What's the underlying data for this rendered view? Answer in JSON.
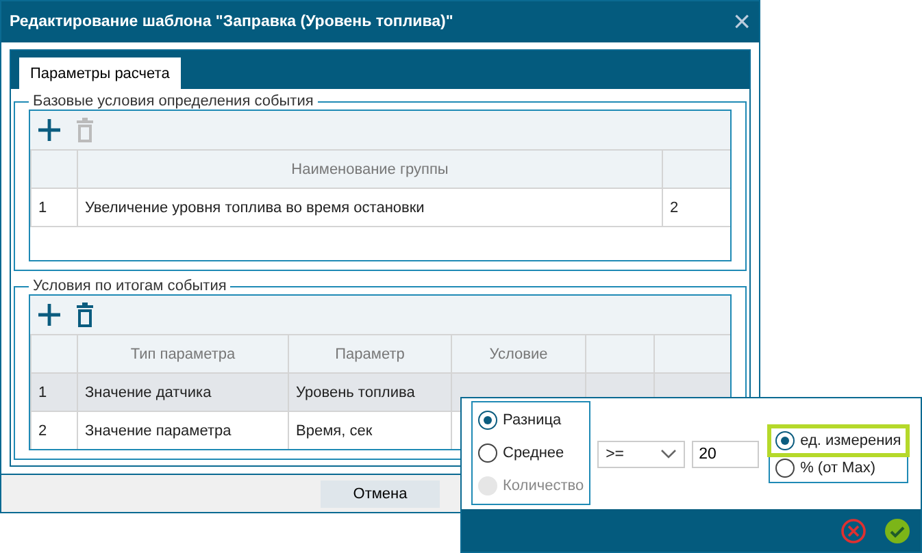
{
  "window": {
    "title": "Редактирование шаблона \"Заправка (Уровень топлива)\"",
    "close": "×"
  },
  "tabs": [
    {
      "label": "Параметры расчета",
      "selected": true
    }
  ],
  "base_section": {
    "legend": "Базовые условия определения события",
    "toolbar": [
      {
        "kind": "add",
        "disabled": false
      },
      {
        "kind": "delete",
        "disabled": true
      }
    ],
    "columns": [
      "",
      "Наименование группы",
      ""
    ],
    "rows": [
      {
        "cells": [
          "1",
          "Увеличение уровня топлива во время остановки",
          "2"
        ],
        "selected": false
      }
    ]
  },
  "result_section": {
    "legend": "Условия по итогам события",
    "toolbar": [
      {
        "kind": "add",
        "disabled": false
      },
      {
        "kind": "delete",
        "disabled": false
      }
    ],
    "columns": [
      "",
      "Тип параметра",
      "Параметр",
      "Условие",
      "",
      ""
    ],
    "rows": [
      {
        "cells": [
          "1",
          "Значение датчика",
          "Уровень топлива"
        ],
        "selected": true
      },
      {
        "cells": [
          "2",
          "Значение параметра",
          "Время, сек"
        ],
        "selected": false
      }
    ]
  },
  "footer": {
    "buttons": [
      "Отмена"
    ]
  },
  "popup": {
    "modes": [
      {
        "label": "Разница",
        "selected": true,
        "disabled": false
      },
      {
        "label": "Среднее",
        "selected": false,
        "disabled": false
      },
      {
        "label": "Количество",
        "selected": false,
        "disabled": true
      }
    ],
    "operator": ">=",
    "value": "20",
    "units": [
      {
        "label": "ед. измерения",
        "selected": true
      },
      {
        "label": "% (от Max)",
        "selected": false
      }
    ]
  }
}
